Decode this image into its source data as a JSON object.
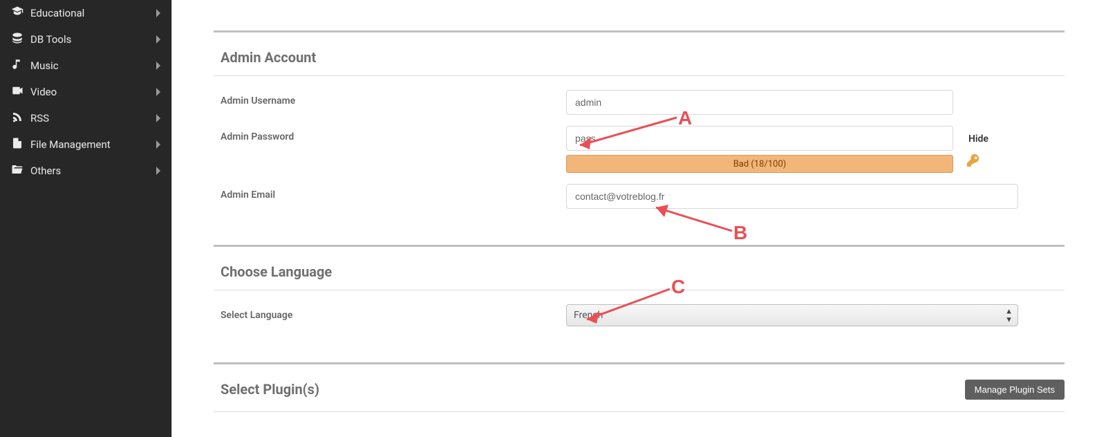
{
  "sidebar": {
    "items": [
      {
        "label": "Educational",
        "icon": "graduation-cap-icon"
      },
      {
        "label": "DB Tools",
        "icon": "database-icon"
      },
      {
        "label": "Music",
        "icon": "music-icon"
      },
      {
        "label": "Video",
        "icon": "video-icon"
      },
      {
        "label": "RSS",
        "icon": "rss-icon"
      },
      {
        "label": "File Management",
        "icon": "file-icon"
      },
      {
        "label": "Others",
        "icon": "folder-open-icon"
      }
    ]
  },
  "sections": {
    "admin": {
      "title": "Admin Account",
      "username_label": "Admin Username",
      "username_value": "admin",
      "password_label": "Admin Password",
      "password_value": "pass",
      "password_toggle": "Hide",
      "strength_text": "Bad (18/100)",
      "email_label": "Admin Email",
      "email_value": "contact@votreblog.fr"
    },
    "language": {
      "title": "Choose Language",
      "select_label": "Select Language",
      "selected": "French"
    },
    "plugins": {
      "title": "Select Plugin(s)",
      "manage_btn": "Manage Plugin Sets"
    }
  },
  "annotations": {
    "a": "A",
    "b": "B",
    "c": "C"
  },
  "colors": {
    "accent_annotation": "#ea4f55",
    "strength_bar_bg": "#f3b679"
  }
}
